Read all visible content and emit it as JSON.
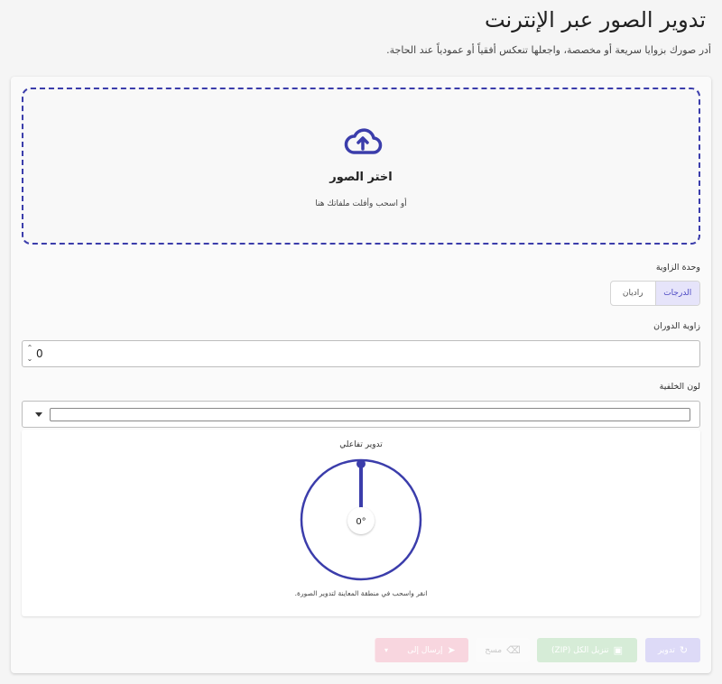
{
  "header": {
    "title": "تدوير الصور عبر الإنترنت",
    "subtitle": "أدر صورك بزوايا سريعة أو مخصصة، واجعلها تنعكس أفقياً أو عمودياً عند الحاجة."
  },
  "dropzone": {
    "icon": "cloud-upload-icon",
    "title": "اختر الصور",
    "hint": "أو اسحب وأفلت ملفاتك هنا"
  },
  "angle_unit": {
    "label": "وحدة الزاوية",
    "options": [
      "الدرجات",
      "راديان"
    ],
    "selected": "الدرجات"
  },
  "rotation_angle": {
    "label": "زاوية الدوران",
    "value": "0"
  },
  "background_color": {
    "label": "لون الخلفية",
    "value": "#ffffff"
  },
  "preview": {
    "title": "تدوير تفاعلي",
    "angle_readout": "0°",
    "hint": "انقر واسحب في منطقة المعاينة لتدوير الصورة."
  },
  "actions": {
    "rotate": "تدوير",
    "download_zip": "تنزيل الكل (ZIP)",
    "clear": "مسح",
    "send_to": "إرسال إلى"
  },
  "colors": {
    "accent": "#3b3dab",
    "rotate_button": "#dddaf7",
    "zip_button": "#d6ecd7",
    "send_button": "#f8d6df"
  }
}
